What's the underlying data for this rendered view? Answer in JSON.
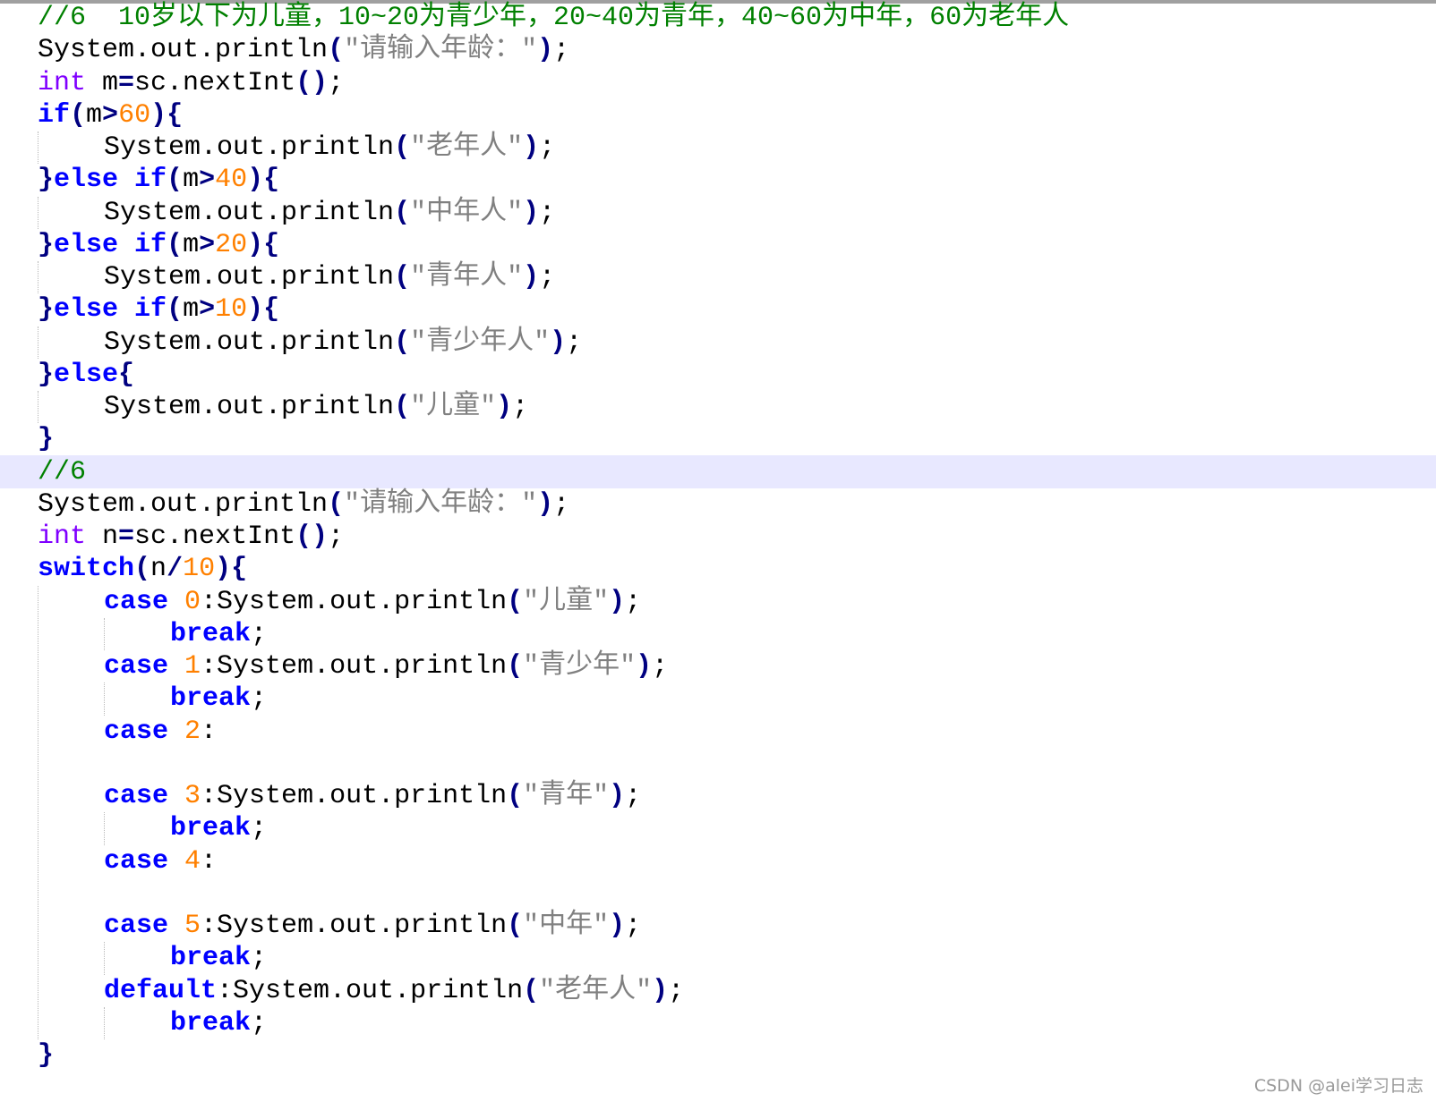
{
  "editor": {
    "lines": [
      {
        "indent": 0,
        "tokens": [
          [
            "comment",
            "//6  10岁以下为儿童，10~20为青少年，20~40为青年，40~60为中年，60为老年人"
          ]
        ]
      },
      {
        "indent": 0,
        "tokens": [
          [
            "plain",
            "System.out.println"
          ],
          [
            "op",
            "("
          ],
          [
            "str",
            "\"请输入年龄：\""
          ],
          [
            "op",
            ")"
          ],
          [
            "plain",
            ";"
          ]
        ]
      },
      {
        "indent": 0,
        "tokens": [
          [
            "type",
            "int"
          ],
          [
            "plain",
            " m"
          ],
          [
            "op",
            "="
          ],
          [
            "plain",
            "sc.nextInt"
          ],
          [
            "op",
            "()"
          ],
          [
            "plain",
            ";"
          ]
        ]
      },
      {
        "indent": 0,
        "tokens": [
          [
            "kw",
            "if"
          ],
          [
            "op",
            "("
          ],
          [
            "plain",
            "m"
          ],
          [
            "op",
            ">"
          ],
          [
            "num",
            "60"
          ],
          [
            "op",
            "){"
          ]
        ]
      },
      {
        "indent": 1,
        "tokens": [
          [
            "plain",
            "System.out.println"
          ],
          [
            "op",
            "("
          ],
          [
            "str",
            "\"老年人\""
          ],
          [
            "op",
            ")"
          ],
          [
            "plain",
            ";"
          ]
        ]
      },
      {
        "indent": 0,
        "tokens": [
          [
            "op",
            "}"
          ],
          [
            "kw",
            "else if"
          ],
          [
            "op",
            "("
          ],
          [
            "plain",
            "m"
          ],
          [
            "op",
            ">"
          ],
          [
            "num",
            "40"
          ],
          [
            "op",
            "){"
          ]
        ]
      },
      {
        "indent": 1,
        "tokens": [
          [
            "plain",
            "System.out.println"
          ],
          [
            "op",
            "("
          ],
          [
            "str",
            "\"中年人\""
          ],
          [
            "op",
            ")"
          ],
          [
            "plain",
            ";"
          ]
        ]
      },
      {
        "indent": 0,
        "tokens": [
          [
            "op",
            "}"
          ],
          [
            "kw",
            "else if"
          ],
          [
            "op",
            "("
          ],
          [
            "plain",
            "m"
          ],
          [
            "op",
            ">"
          ],
          [
            "num",
            "20"
          ],
          [
            "op",
            "){"
          ]
        ]
      },
      {
        "indent": 1,
        "tokens": [
          [
            "plain",
            "System.out.println"
          ],
          [
            "op",
            "("
          ],
          [
            "str",
            "\"青年人\""
          ],
          [
            "op",
            ")"
          ],
          [
            "plain",
            ";"
          ]
        ]
      },
      {
        "indent": 0,
        "tokens": [
          [
            "op",
            "}"
          ],
          [
            "kw",
            "else if"
          ],
          [
            "op",
            "("
          ],
          [
            "plain",
            "m"
          ],
          [
            "op",
            ">"
          ],
          [
            "num",
            "10"
          ],
          [
            "op",
            "){"
          ]
        ]
      },
      {
        "indent": 1,
        "tokens": [
          [
            "plain",
            "System.out.println"
          ],
          [
            "op",
            "("
          ],
          [
            "str",
            "\"青少年人\""
          ],
          [
            "op",
            ")"
          ],
          [
            "plain",
            ";"
          ]
        ]
      },
      {
        "indent": 0,
        "tokens": [
          [
            "op",
            "}"
          ],
          [
            "kw",
            "else"
          ],
          [
            "op",
            "{"
          ]
        ]
      },
      {
        "indent": 1,
        "tokens": [
          [
            "plain",
            "System.out.println"
          ],
          [
            "op",
            "("
          ],
          [
            "str",
            "\"儿童\""
          ],
          [
            "op",
            ")"
          ],
          [
            "plain",
            ";"
          ]
        ]
      },
      {
        "indent": 0,
        "tokens": [
          [
            "op",
            "}"
          ]
        ]
      },
      {
        "indent": 0,
        "highlight": true,
        "tokens": [
          [
            "comment",
            "//6"
          ]
        ]
      },
      {
        "indent": 0,
        "tokens": [
          [
            "plain",
            "System.out.println"
          ],
          [
            "op",
            "("
          ],
          [
            "str",
            "\"请输入年龄：\""
          ],
          [
            "op",
            ")"
          ],
          [
            "plain",
            ";"
          ]
        ]
      },
      {
        "indent": 0,
        "tokens": [
          [
            "type",
            "int"
          ],
          [
            "plain",
            " n"
          ],
          [
            "op",
            "="
          ],
          [
            "plain",
            "sc.nextInt"
          ],
          [
            "op",
            "()"
          ],
          [
            "plain",
            ";"
          ]
        ]
      },
      {
        "indent": 0,
        "tokens": [
          [
            "kw",
            "switch"
          ],
          [
            "op",
            "("
          ],
          [
            "plain",
            "n"
          ],
          [
            "op",
            "/"
          ],
          [
            "num",
            "10"
          ],
          [
            "op",
            "){"
          ]
        ]
      },
      {
        "indent": 1,
        "tokens": [
          [
            "kw",
            "case"
          ],
          [
            "plain",
            " "
          ],
          [
            "num",
            "0"
          ],
          [
            "plain",
            ":System.out.println"
          ],
          [
            "op",
            "("
          ],
          [
            "str",
            "\"儿童\""
          ],
          [
            "op",
            ")"
          ],
          [
            "plain",
            ";"
          ]
        ]
      },
      {
        "indent": 2,
        "tokens": [
          [
            "kw",
            "break"
          ],
          [
            "plain",
            ";"
          ]
        ]
      },
      {
        "indent": 1,
        "tokens": [
          [
            "kw",
            "case"
          ],
          [
            "plain",
            " "
          ],
          [
            "num",
            "1"
          ],
          [
            "plain",
            ":System.out.println"
          ],
          [
            "op",
            "("
          ],
          [
            "str",
            "\"青少年\""
          ],
          [
            "op",
            ")"
          ],
          [
            "plain",
            ";"
          ]
        ]
      },
      {
        "indent": 2,
        "tokens": [
          [
            "kw",
            "break"
          ],
          [
            "plain",
            ";"
          ]
        ]
      },
      {
        "indent": 1,
        "tokens": [
          [
            "kw",
            "case"
          ],
          [
            "plain",
            " "
          ],
          [
            "num",
            "2"
          ],
          [
            "plain",
            ":"
          ]
        ]
      },
      {
        "indent": 1,
        "tokens": []
      },
      {
        "indent": 1,
        "tokens": [
          [
            "kw",
            "case"
          ],
          [
            "plain",
            " "
          ],
          [
            "num",
            "3"
          ],
          [
            "plain",
            ":System.out.println"
          ],
          [
            "op",
            "("
          ],
          [
            "str",
            "\"青年\""
          ],
          [
            "op",
            ")"
          ],
          [
            "plain",
            ";"
          ]
        ]
      },
      {
        "indent": 2,
        "tokens": [
          [
            "kw",
            "break"
          ],
          [
            "plain",
            ";"
          ]
        ]
      },
      {
        "indent": 1,
        "tokens": [
          [
            "kw",
            "case"
          ],
          [
            "plain",
            " "
          ],
          [
            "num",
            "4"
          ],
          [
            "plain",
            ":"
          ]
        ]
      },
      {
        "indent": 1,
        "tokens": []
      },
      {
        "indent": 1,
        "tokens": [
          [
            "kw",
            "case"
          ],
          [
            "plain",
            " "
          ],
          [
            "num",
            "5"
          ],
          [
            "plain",
            ":System.out.println"
          ],
          [
            "op",
            "("
          ],
          [
            "str",
            "\"中年\""
          ],
          [
            "op",
            ")"
          ],
          [
            "plain",
            ";"
          ]
        ]
      },
      {
        "indent": 2,
        "tokens": [
          [
            "kw",
            "break"
          ],
          [
            "plain",
            ";"
          ]
        ]
      },
      {
        "indent": 1,
        "tokens": [
          [
            "kw",
            "default"
          ],
          [
            "plain",
            ":System.out.println"
          ],
          [
            "op",
            "("
          ],
          [
            "str",
            "\"老年人\""
          ],
          [
            "op",
            ")"
          ],
          [
            "plain",
            ";"
          ]
        ]
      },
      {
        "indent": 2,
        "tokens": [
          [
            "kw",
            "break"
          ],
          [
            "plain",
            ";"
          ]
        ]
      },
      {
        "indent": 0,
        "tokens": [
          [
            "op",
            "}"
          ]
        ]
      }
    ]
  },
  "watermark": {
    "text": "CSDN @alei学习日志"
  },
  "colors": {
    "comment": "#008000",
    "keyword": "#0000ff",
    "type": "#8000ff",
    "number": "#ff8000",
    "string": "#808080",
    "operator": "#000080",
    "current_line_highlight": "#e8e8ff"
  }
}
